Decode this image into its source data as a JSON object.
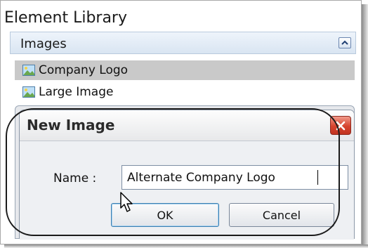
{
  "library": {
    "title": "Element Library",
    "section": {
      "label": "Images",
      "collapse_icon": "chevron-up-icon"
    },
    "items": [
      {
        "label": "Company Logo",
        "icon": "image-icon",
        "selected": true
      },
      {
        "label": "Large Image",
        "icon": "image-icon",
        "selected": false
      }
    ]
  },
  "dialog": {
    "title": "New Image",
    "close_icon": "close-icon",
    "name_label": "Name :",
    "name_value": "Alternate Company Logo",
    "ok_label": "OK",
    "cancel_label": "Cancel"
  },
  "colors": {
    "close_button": "#d6432e",
    "selected_row": "#c9c9c9",
    "section_header": "#d9e5f2"
  }
}
